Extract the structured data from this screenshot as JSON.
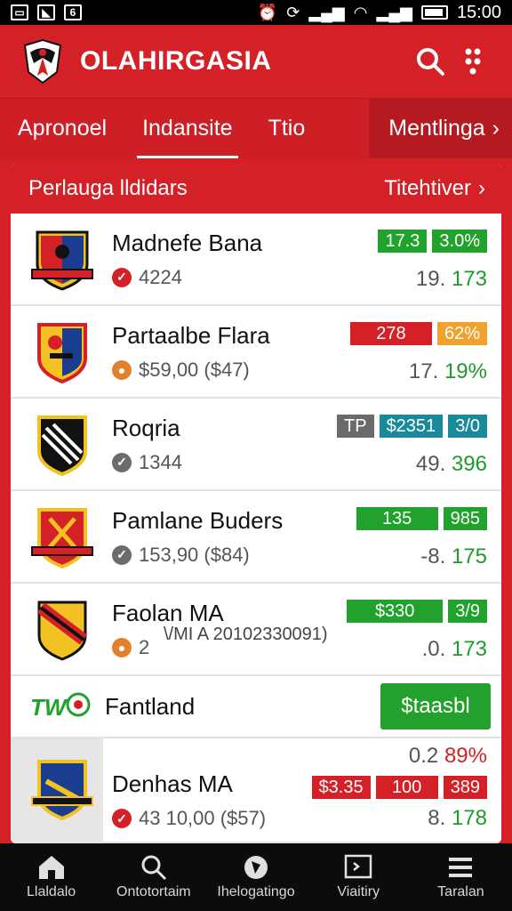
{
  "status_bar": {
    "left_icon_label": "6",
    "time": "15:00"
  },
  "app": {
    "title": "OLAHIRGASIA"
  },
  "tabs": [
    {
      "label": "Apronoel"
    },
    {
      "label": "Indansite"
    },
    {
      "label": "Ttio"
    },
    {
      "label": "Mentlinga"
    }
  ],
  "panel": {
    "title": "Perlauga lldidars",
    "link_label": "Titehtiver",
    "rows": [
      {
        "name": "Madnefe Bana",
        "sub": "4224",
        "badge1": "17.3",
        "badge2": "3.0%",
        "stat_prefix": "19.",
        "stat_value": "173"
      },
      {
        "name": "Partaalbe Flara",
        "sub": "$59,00 ($47)",
        "badge1": "278",
        "badge2": "62%",
        "stat_prefix": "17.",
        "stat_value": "19%"
      },
      {
        "name": "Roqria",
        "sub": "1344",
        "badge0": "TP",
        "badge1": "$2351",
        "badge2": "3/0",
        "stat_prefix": "49.",
        "stat_value": "396"
      },
      {
        "name": "Pamlane Buders",
        "sub": "153,90 ($84)",
        "badge1": "135",
        "badge2": "985",
        "stat_prefix": "-8.",
        "stat_value": "175"
      },
      {
        "name": "Faolan MA",
        "sub": "2",
        "note": "\\/MI A 20102330091)",
        "badge1": "$330",
        "badge2": "3/9",
        "stat_prefix": ".0.",
        "stat_value": "173"
      }
    ],
    "feature": {
      "name": "Fantland",
      "button_label": "$taasbl"
    },
    "last_row": {
      "name": "Denhas MA",
      "sub": "43 10,00 ($57)",
      "top_stat_prefix": "0.2",
      "top_stat_value": "89%",
      "badge0": "$3.35",
      "badge1": "100",
      "badge2": "389",
      "stat_prefix": "8.",
      "stat_value": "178"
    }
  },
  "bottom_nav": [
    {
      "label": "Llaldalo",
      "icon": "home-icon"
    },
    {
      "label": "Ontotortaim",
      "icon": "search-icon"
    },
    {
      "label": "Ihelogatingo",
      "icon": "ball-icon"
    },
    {
      "label": "Viaitiry",
      "icon": "screen-icon"
    },
    {
      "label": "Taralan",
      "icon": "menu-icon"
    }
  ],
  "colors": {
    "brand_red": "#d42027",
    "green": "#21a22d",
    "orange": "#f0a12e",
    "teal": "#1a8a9a"
  }
}
